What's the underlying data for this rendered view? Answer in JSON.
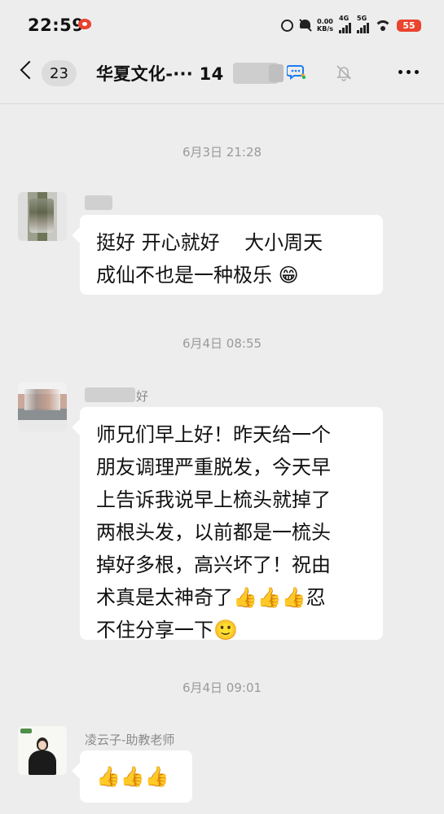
{
  "status_bar": {
    "time": "22:59",
    "net_speed_top": "0.00",
    "net_speed_unit": "KB/s",
    "signal1_label": "4G",
    "signal2_label": "5G",
    "battery": "55"
  },
  "nav": {
    "unread_count": "23",
    "chat_title": "华夏文化-··· 14"
  },
  "messages": [
    {
      "timestamp": "6月3日 21:28",
      "sender": "",
      "lines": [
        "挺好 开心就好    大小周天",
        "成仙不也是一种极乐 "
      ],
      "emoji_end": "😁"
    },
    {
      "timestamp": "6月4日 08:55",
      "sender": "好",
      "lines": [
        "师兄们早上好！昨天给一个",
        "朋友调理严重脱发，今天早",
        "上告诉我说早上梳头就掉了",
        "两根头发，以前都是一梳头",
        "掉好多根，高兴坏了！祝由"
      ],
      "line6_text": "术真是太神奇了",
      "line6_emoji": "👍👍👍",
      "line6_tail": "忍",
      "line7_text": "不住分享一下",
      "line7_emoji": "🙂"
    },
    {
      "timestamp": "6月4日 09:01",
      "sender": "凌云子-助教老师",
      "emoji_only": "👍👍👍"
    }
  ]
}
